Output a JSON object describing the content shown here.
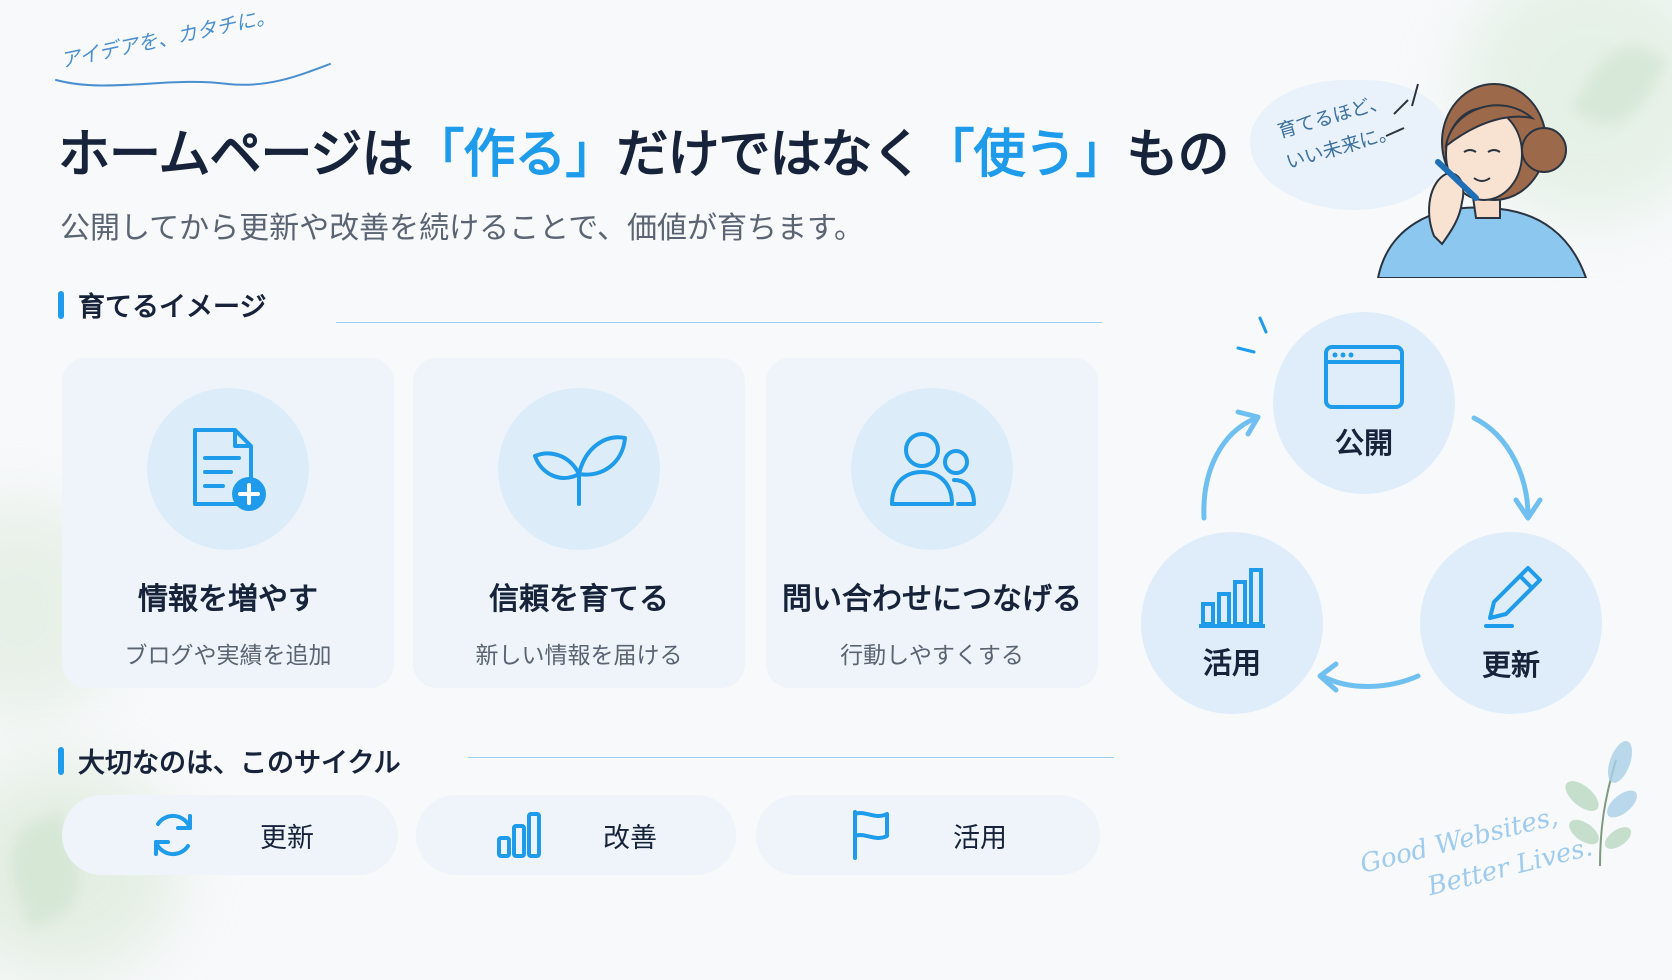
{
  "tagline": "アイデアを、カタチに。",
  "title": {
    "part1": "ホームページは",
    "highlight1": "「作る」",
    "part2": "だけではなく",
    "highlight2": "「使う」",
    "part3": "もの"
  },
  "subtitle": "公開してから更新や改善を続けることで、価値が育ちます。",
  "bubble": {
    "line1": "育てるほど、",
    "line2": "いい未来に。"
  },
  "section1": {
    "label": "育てるイメージ"
  },
  "cards": [
    {
      "icon": "document-add-icon",
      "title": "情報を増やす",
      "sub": "ブログや実績を追加"
    },
    {
      "icon": "sprout-icon",
      "title": "信頼を育てる",
      "sub": "新しい情報を届ける"
    },
    {
      "icon": "users-icon",
      "title": "問い合わせにつなげる",
      "sub": "行動しやすくする"
    }
  ],
  "section2": {
    "label": "大切なのは、このサイクル"
  },
  "pills": [
    {
      "icon": "refresh-icon",
      "label": "更新"
    },
    {
      "icon": "bar-chart-icon",
      "label": "改善"
    },
    {
      "icon": "flag-icon",
      "label": "活用"
    }
  ],
  "cycle": [
    {
      "icon": "browser-window-icon",
      "label": "公開"
    },
    {
      "icon": "pencil-icon",
      "label": "更新"
    },
    {
      "icon": "bar-chart-icon",
      "label": "活用"
    }
  ],
  "footer": {
    "line1": "Good Websites,",
    "line2": "Better Lives."
  },
  "colors": {
    "accent": "#1e9bea",
    "text": "#17233a",
    "muted": "#5a6472",
    "card_bg": "#eef4fa",
    "circle_bg": "#dcedf9"
  }
}
